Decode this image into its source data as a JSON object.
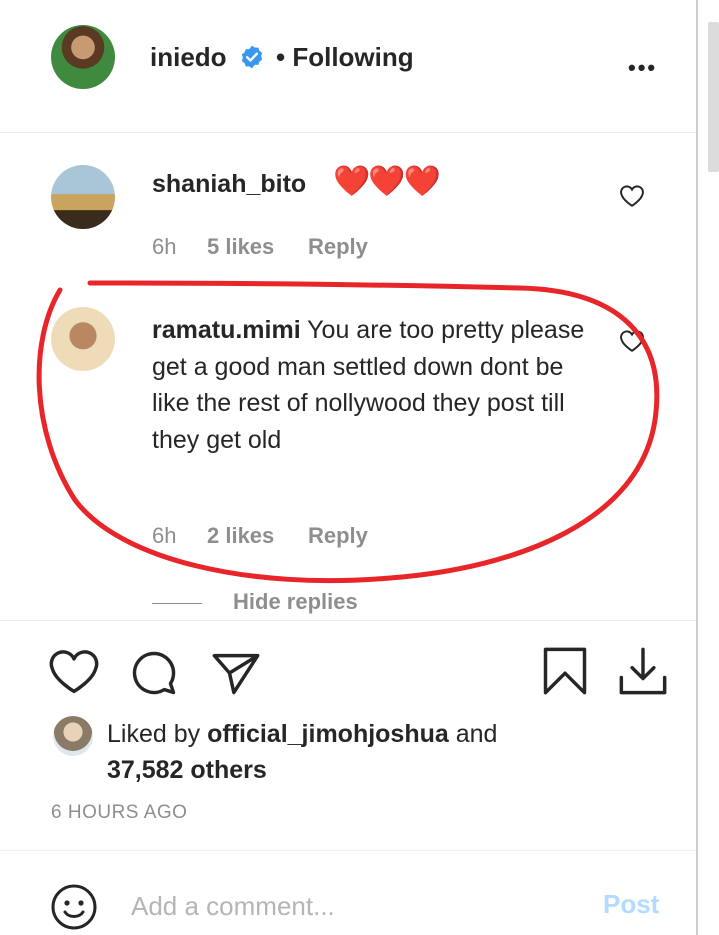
{
  "post_header": {
    "username": "iniedo",
    "separator": "•",
    "follow_status": "Following",
    "more_icon": "more-options-icon"
  },
  "comments": [
    {
      "username": "shaniah_bito",
      "text": "❤️❤️❤️",
      "time": "6h",
      "likes": "5 likes",
      "reply_label": "Reply"
    },
    {
      "username": "ramatu.mimi",
      "text": "You are too pretty please get a good man settled down dont be like the rest of nollywood they post till they get old",
      "time": "6h",
      "likes": "2 likes",
      "reply_label": "Reply"
    }
  ],
  "hide_replies_label": "Hide replies",
  "likes": {
    "prefix": "Liked by",
    "user": "official_jimohjoshua",
    "conjunction": "and",
    "others": "37,582 others"
  },
  "timestamp": "6 HOURS AGO",
  "add_comment": {
    "placeholder": "Add a comment...",
    "post_label": "Post"
  },
  "colors": {
    "text": "#262626",
    "muted": "#8e8e8e",
    "post_disabled": "#b3dbff",
    "verified_blue": "#3897f0",
    "annotation_red": "#e8262a"
  }
}
